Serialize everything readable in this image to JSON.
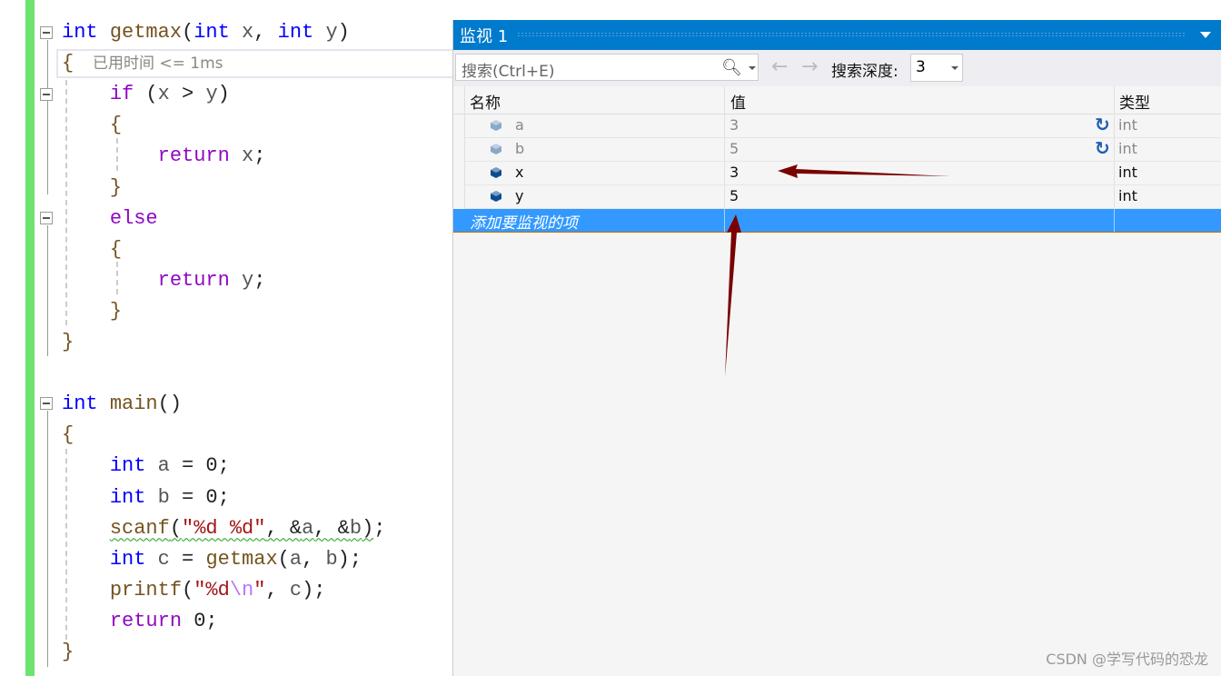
{
  "editor": {
    "hint": "已用时间 <= 1ms",
    "lines": [
      [
        [
          "kw",
          "int"
        ],
        [
          "pun",
          " "
        ],
        [
          "fn",
          "getmax"
        ],
        [
          "pun",
          "("
        ],
        [
          "kw",
          "int"
        ],
        [
          "var",
          " x"
        ],
        [
          "pun",
          ", "
        ],
        [
          "kw",
          "int"
        ],
        [
          "var",
          " y"
        ],
        [
          "pun",
          ")"
        ]
      ],
      [
        [
          "fn",
          "{"
        ]
      ],
      [
        [
          "pun",
          "    "
        ],
        [
          "ctl",
          "if"
        ],
        [
          "pun",
          " ("
        ],
        [
          "var",
          "x"
        ],
        [
          "pun",
          " > "
        ],
        [
          "var",
          "y"
        ],
        [
          "pun",
          ")"
        ]
      ],
      [
        [
          "pun",
          "    "
        ],
        [
          "fn",
          "{"
        ]
      ],
      [
        [
          "pun",
          "        "
        ],
        [
          "ctl",
          "return"
        ],
        [
          "var",
          " x"
        ],
        [
          "pun",
          ";"
        ]
      ],
      [
        [
          "pun",
          "    "
        ],
        [
          "fn",
          "}"
        ]
      ],
      [
        [
          "pun",
          "    "
        ],
        [
          "ctl",
          "else"
        ]
      ],
      [
        [
          "pun",
          "    "
        ],
        [
          "fn",
          "{"
        ]
      ],
      [
        [
          "pun",
          "        "
        ],
        [
          "ctl",
          "return"
        ],
        [
          "var",
          " y"
        ],
        [
          "pun",
          ";"
        ]
      ],
      [
        [
          "pun",
          "    "
        ],
        [
          "fn",
          "}"
        ]
      ],
      [
        [
          "fn",
          "}"
        ]
      ],
      [],
      [
        [
          "kw",
          "int"
        ],
        [
          "pun",
          " "
        ],
        [
          "fn",
          "main"
        ],
        [
          "pun",
          "()"
        ]
      ],
      [
        [
          "fn",
          "{"
        ]
      ],
      [
        [
          "pun",
          "    "
        ],
        [
          "kw",
          "int"
        ],
        [
          "var",
          " a"
        ],
        [
          "pun",
          " = 0;"
        ]
      ],
      [
        [
          "pun",
          "    "
        ],
        [
          "kw",
          "int"
        ],
        [
          "var",
          " b"
        ],
        [
          "pun",
          " = 0;"
        ]
      ],
      [
        [
          "pun",
          "    "
        ],
        [
          "fn squig",
          "scanf"
        ],
        [
          "pun squig",
          "("
        ],
        [
          "str squig",
          "\"%d %d\""
        ],
        [
          "pun squig",
          ", &"
        ],
        [
          "var squig",
          "a"
        ],
        [
          "pun squig",
          ", &"
        ],
        [
          "var squig",
          "b"
        ],
        [
          "pun squig",
          ")"
        ],
        [
          "pun",
          ";"
        ]
      ],
      [
        [
          "pun",
          "    "
        ],
        [
          "kw",
          "int"
        ],
        [
          "var",
          " c"
        ],
        [
          "pun",
          " = "
        ],
        [
          "fn",
          "getmax"
        ],
        [
          "pun",
          "("
        ],
        [
          "var",
          "a"
        ],
        [
          "pun",
          ", "
        ],
        [
          "var",
          "b"
        ],
        [
          "pun",
          ");"
        ]
      ],
      [
        [
          "pun",
          "    "
        ],
        [
          "fn",
          "printf"
        ],
        [
          "pun",
          "("
        ],
        [
          "str",
          "\"%d"
        ],
        [
          "esc",
          "\\n"
        ],
        [
          "str",
          "\""
        ],
        [
          "pun",
          ", "
        ],
        [
          "var",
          "c"
        ],
        [
          "pun",
          ");"
        ]
      ],
      [
        [
          "pun",
          "    "
        ],
        [
          "ctl",
          "return"
        ],
        [
          "pun",
          " 0;"
        ]
      ],
      [
        [
          "fn",
          "}"
        ]
      ]
    ]
  },
  "watch": {
    "title": "监视 1",
    "search_placeholder": "搜索(Ctrl+E)",
    "depth_label": "搜索深度:",
    "depth_value": "3",
    "columns": [
      "名称",
      "值",
      "类型"
    ],
    "rows": [
      {
        "name": "a",
        "value": "3",
        "type": "int",
        "stale": true
      },
      {
        "name": "b",
        "value": "5",
        "type": "int",
        "stale": true
      },
      {
        "name": "x",
        "value": "3",
        "type": "int",
        "stale": false
      },
      {
        "name": "y",
        "value": "5",
        "type": "int",
        "stale": false
      }
    ],
    "add_item": "添加要监视的项"
  },
  "annotation_color": "#7a0000",
  "watermark": "CSDN @学写代码的恐龙"
}
